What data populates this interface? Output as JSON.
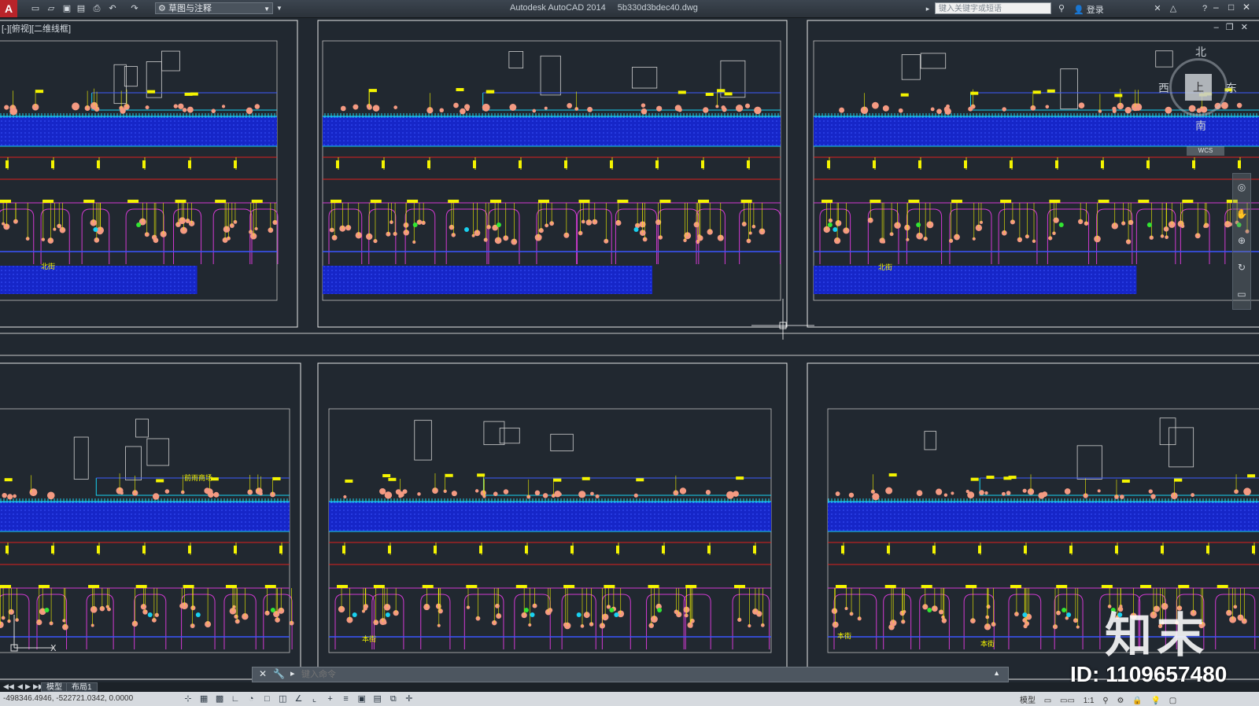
{
  "titlebar": {
    "logo": "A",
    "workspace": "草图与注释",
    "app_name": "Autodesk AutoCAD 2014",
    "file_name": "5b330d3bdec40.dwg",
    "search_placeholder": "键入关键字或短语",
    "login_label": "登录"
  },
  "viewport": {
    "label": "[-][俯视][二维线框]",
    "minimize": "–",
    "restore": "❐",
    "close": "✕"
  },
  "viewcube": {
    "north": "北",
    "south": "南",
    "east": "东",
    "west": "西",
    "top": "上",
    "wcs": "WCS"
  },
  "annotations": {
    "label_1": "北街",
    "label_2": "北街",
    "label_3": "前雨商场",
    "label_4": "本街",
    "label_5": "本街",
    "label_6": "本街"
  },
  "command": {
    "prompt": "▸",
    "placeholder": "键入命令"
  },
  "tabs": [
    {
      "label": "模型"
    },
    {
      "label": "布局1"
    }
  ],
  "status": {
    "coordinates": "-498346.4946, -522721.0342, 0.0000",
    "model_label": "模型",
    "scale": "1:1"
  },
  "watermark": {
    "logo_text": "知末",
    "id_text": "ID: 1109657480"
  },
  "colors": {
    "background": "#212830",
    "hatch_blue": "#1a2fd6",
    "cyan": "#19d1f0",
    "yellow": "#f4f400",
    "magenta": "#d23ad2",
    "salmon": "#f49a82",
    "red": "#e0201e",
    "green": "#32e632",
    "white_frame": "#e8e8e8"
  }
}
